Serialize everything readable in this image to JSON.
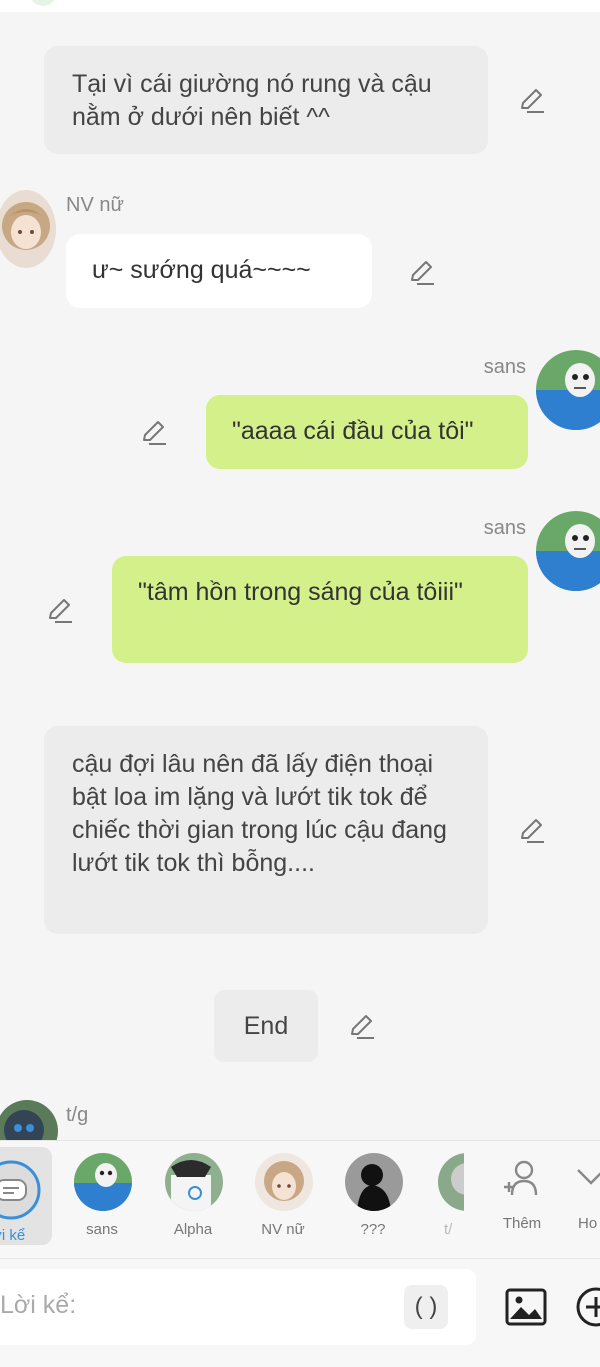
{
  "messages": [
    {
      "kind": "narration",
      "text": "Tại vì cái giường nó rung và cậu nằm ở dưới nên biết ^^"
    },
    {
      "kind": "character-left",
      "name": "NV nữ",
      "text": "ư~ sướng quá~~~~"
    },
    {
      "kind": "character-right",
      "name": "sans",
      "text": "\"aaaa cái đầu của tôi\""
    },
    {
      "kind": "character-right",
      "name": "sans",
      "text": "\"tâm hồn trong sáng của tôiii\""
    },
    {
      "kind": "narration",
      "text": "cậu đợi lâu nên đã lấy điện thoại bật loa im lặng và lướt tik tok để chiếc thời gian trong lúc cậu đang lướt tik tok thì bỗng...."
    },
    {
      "kind": "end",
      "text": "End"
    },
    {
      "kind": "character-left-partial",
      "name": "t/g"
    }
  ],
  "character_bar": {
    "narrator_label": "ời kể",
    "characters": [
      {
        "name": "sans",
        "icon": "sans-avatar"
      },
      {
        "name": "Alpha",
        "icon": "alpha-avatar"
      },
      {
        "name": "NV nữ",
        "icon": "nv-nu-avatar"
      },
      {
        "name": "???",
        "icon": "silhouette-avatar"
      },
      {
        "name": "t/",
        "icon": "tg-avatar"
      }
    ],
    "more_label": "Thêm",
    "cut_label": "Ho"
  },
  "input": {
    "placeholder": "Lời kể:",
    "paren_button": "( )"
  },
  "colors": {
    "narration_bg": "#ececec",
    "green_bubble": "#d4f08a",
    "white_bubble": "#ffffff",
    "accent_blue": "#3a8fd8"
  }
}
